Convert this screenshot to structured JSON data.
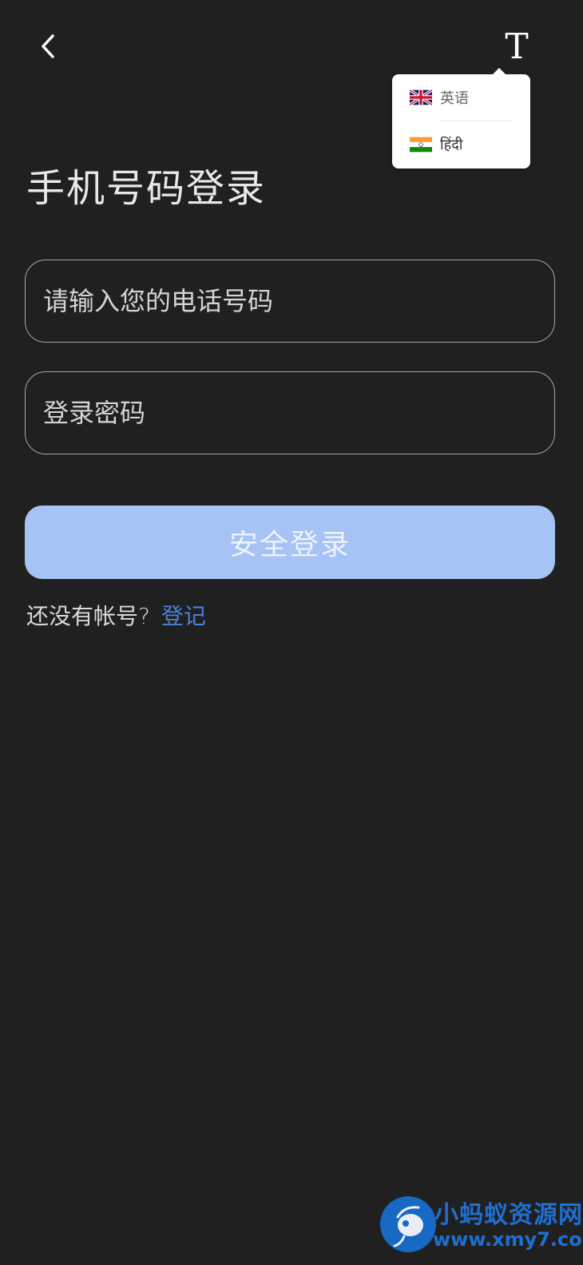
{
  "header": {
    "back_icon": "chevron-left-icon",
    "language_button": "T"
  },
  "language_menu": {
    "items": [
      {
        "flag": "uk-flag-icon",
        "label": "英语"
      },
      {
        "flag": "india-flag-icon",
        "label": "हिंदी"
      }
    ]
  },
  "page": {
    "title": "手机号码登录"
  },
  "form": {
    "phone_placeholder": "请输入您的电话号码",
    "phone_value": "",
    "password_placeholder": "登录密码",
    "password_value": "",
    "submit_label": "安全登录"
  },
  "register": {
    "prompt": "还没有帐号?",
    "link_label": "登记"
  },
  "watermark": {
    "title": "小蚂蚁资源网",
    "url": "www.xmy7.com"
  },
  "colors": {
    "background": "#202020",
    "button": "#a5c3f5",
    "link": "#4d7fd8",
    "watermark": "#1e6fd0"
  }
}
